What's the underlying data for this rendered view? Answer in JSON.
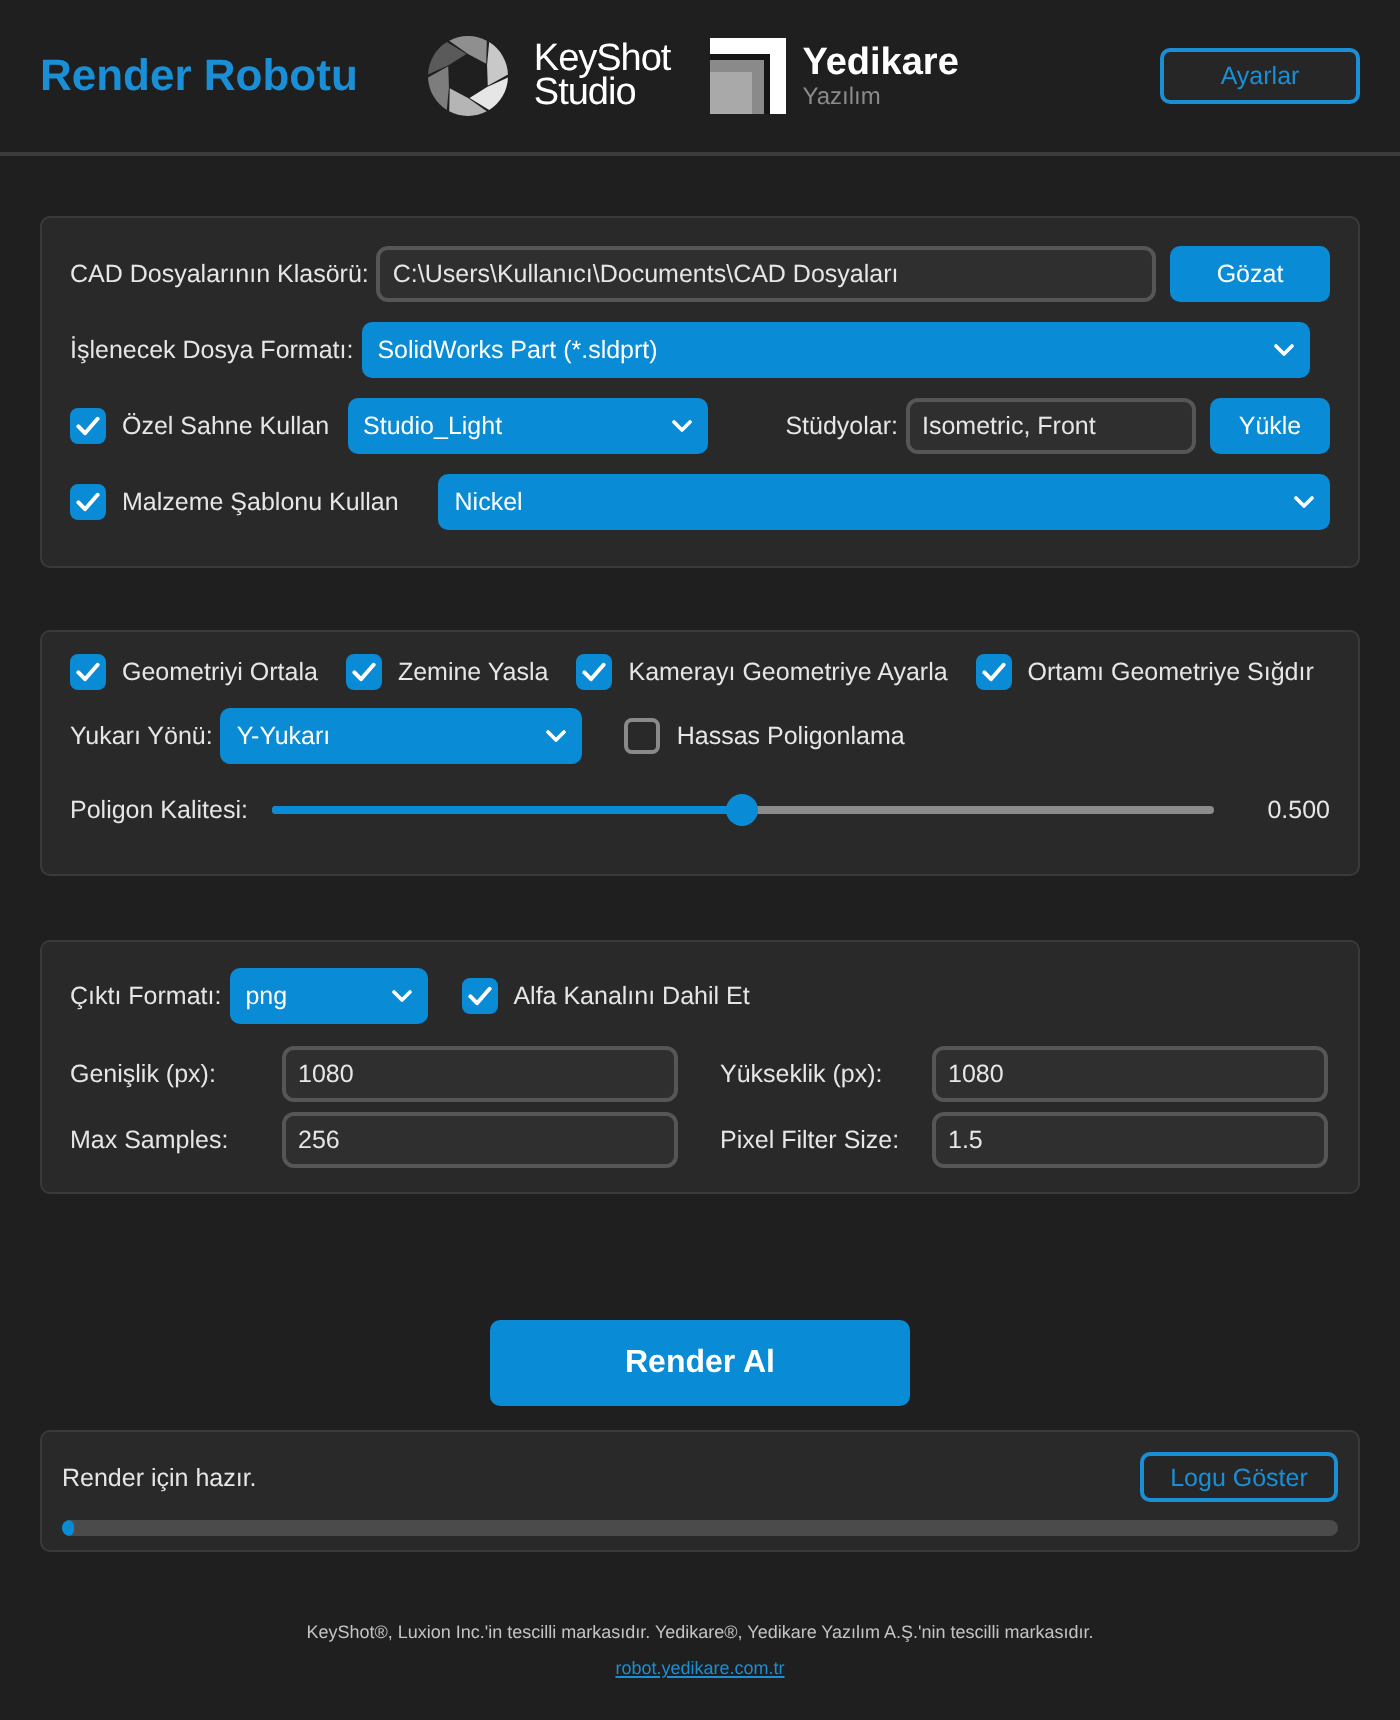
{
  "header": {
    "title": "Render Robotu",
    "logos": [
      {
        "kind": "keyshot",
        "name": "KeyShot",
        "subtitle": "Studio"
      },
      {
        "kind": "yedikare",
        "name": "Yedikare",
        "subtitle": "Yazılım"
      }
    ],
    "settings_button": "Ayarlar"
  },
  "source_panel": {
    "folder": {
      "label": "CAD Dosyalarının Klasörü:",
      "value": "C:\\Users\\Kullanıcı\\Documents\\CAD Dosyaları",
      "button": "Gözat"
    },
    "format": {
      "label": "İşlenecek Dosya Formatı:",
      "value": "SolidWorks Part (*.sldprt)"
    },
    "scene": {
      "label": "Özel Sahne Kullan",
      "checked": true,
      "value": "Studio_Light"
    },
    "studios": {
      "label": "Stüdyolar:",
      "value": "Isometric, Front",
      "button": "Yükle"
    },
    "material": {
      "label": "Malzeme Şablonu Kullan",
      "checked": true,
      "value": "Nickel"
    }
  },
  "geometry_panel": {
    "options": [
      {
        "label": "Geometriyi Ortala",
        "checked": true
      },
      {
        "label": "Zemine Yasla",
        "checked": true
      },
      {
        "label": "Kamerayı Geometriye Ayarla",
        "checked": true
      },
      {
        "label": "Ortamı Geometriye Sığdır",
        "checked": true
      }
    ],
    "up_axis": {
      "label": "Yukarı Yönü:",
      "value": "Y-Yukarı"
    },
    "precise": {
      "label": "Hassas Poligonlama",
      "checked": false
    },
    "quality": {
      "label": "Poligon Kalitesi:",
      "level": 0.5,
      "reading": "0.500"
    }
  },
  "output_panel": {
    "format": {
      "label": "Çıktı Formatı:",
      "value": "png"
    },
    "alpha": {
      "label": "Alfa Kanalını Dahil Et",
      "checked": true
    },
    "fields": [
      {
        "label": "Genişlik (px):",
        "value": "1080"
      },
      {
        "label": "Yükseklik (px):",
        "value": "1080"
      },
      {
        "label": "Max Samples:",
        "value": "256"
      },
      {
        "label": "Pixel Filter Size:",
        "value": "1.5"
      }
    ]
  },
  "render_button": "Render Al",
  "status_panel": {
    "message": "Render için hazır.",
    "button": "Logu Göster",
    "progress": {
      "level": 0.01
    }
  },
  "footer": {
    "notice": "KeyShot®, Luxion Inc.'in tescilli markasıdır. Yedikare®, Yedikare Yazılım A.Ş.'nin tescilli markasıdır.",
    "link": "robot.yedikare.com.tr"
  }
}
